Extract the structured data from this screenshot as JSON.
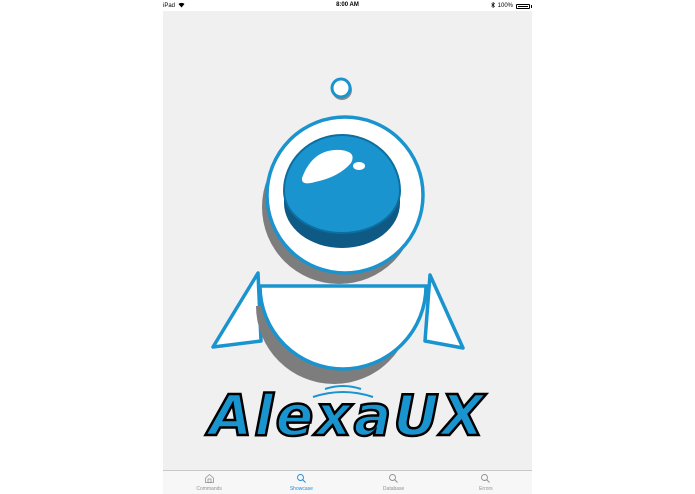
{
  "status_bar": {
    "device": "iPad",
    "time": "8:00 AM",
    "battery": "100%",
    "battery_level": 1.0,
    "icons": [
      "wifi-icon",
      "bluetooth-icon",
      "battery-icon"
    ]
  },
  "brand": {
    "name": "AlexaUX",
    "color": "#1a94cf"
  },
  "tabs": [
    {
      "label": "Commands",
      "icon": "home-icon",
      "active": false
    },
    {
      "label": "Showcase",
      "icon": "search-icon",
      "active": true
    },
    {
      "label": "Database",
      "icon": "search-icon",
      "active": false
    },
    {
      "label": "Errors",
      "icon": "search-icon",
      "active": false
    }
  ],
  "colors": {
    "accent": "#1a8fe0",
    "inactive_tab": "#929292",
    "logo_blue": "#1a94cf"
  }
}
